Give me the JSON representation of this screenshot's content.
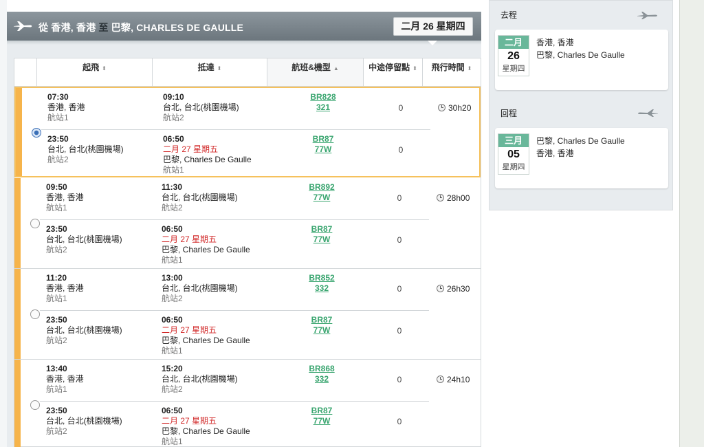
{
  "header": {
    "route_prefix": "從",
    "origin": "香港, 香港",
    "to_word": "至",
    "destination": "巴黎, CHARLES DE GAULLE",
    "selected_date": "二月 26 星期四"
  },
  "columns": [
    {
      "label": "起飛",
      "sort": "⬍"
    },
    {
      "label": "抵達",
      "sort": "⬍"
    },
    {
      "label": "航班&機型",
      "sort": "▲"
    },
    {
      "label": "中途停留點",
      "sort": "⬍"
    },
    {
      "label": "飛行時間",
      "sort": "⬍"
    }
  ],
  "itineraries": [
    {
      "selected": true,
      "duration": "30h20",
      "segments": [
        {
          "dep_time": "07:30",
          "dep_city": "香港, 香港",
          "dep_terminal": "航站1",
          "arr_time": "09:10",
          "arr_date": "",
          "arr_city": "台北, 台北(桃園機場)",
          "arr_terminal": "航站2",
          "flight": "BR828",
          "aircraft": "321",
          "stops": "0"
        },
        {
          "dep_time": "23:50",
          "dep_city": "台北, 台北(桃園機場)",
          "dep_terminal": "航站2",
          "arr_time": "06:50",
          "arr_date": "二月 27 星期五",
          "arr_city": "巴黎, Charles De Gaulle",
          "arr_terminal": "航站1",
          "flight": "BR87",
          "aircraft": "77W",
          "stops": "0"
        }
      ]
    },
    {
      "selected": false,
      "duration": "28h00",
      "segments": [
        {
          "dep_time": "09:50",
          "dep_city": "香港, 香港",
          "dep_terminal": "航站1",
          "arr_time": "11:30",
          "arr_date": "",
          "arr_city": "台北, 台北(桃園機場)",
          "arr_terminal": "航站2",
          "flight": "BR892",
          "aircraft": "77W",
          "stops": "0"
        },
        {
          "dep_time": "23:50",
          "dep_city": "台北, 台北(桃園機場)",
          "dep_terminal": "航站2",
          "arr_time": "06:50",
          "arr_date": "二月 27 星期五",
          "arr_city": "巴黎, Charles De Gaulle",
          "arr_terminal": "航站1",
          "flight": "BR87",
          "aircraft": "77W",
          "stops": "0"
        }
      ]
    },
    {
      "selected": false,
      "duration": "26h30",
      "segments": [
        {
          "dep_time": "11:20",
          "dep_city": "香港, 香港",
          "dep_terminal": "航站1",
          "arr_time": "13:00",
          "arr_date": "",
          "arr_city": "台北, 台北(桃園機場)",
          "arr_terminal": "航站2",
          "flight": "BR852",
          "aircraft": "332",
          "stops": "0"
        },
        {
          "dep_time": "23:50",
          "dep_city": "台北, 台北(桃園機場)",
          "dep_terminal": "航站2",
          "arr_time": "06:50",
          "arr_date": "二月 27 星期五",
          "arr_city": "巴黎, Charles De Gaulle",
          "arr_terminal": "航站1",
          "flight": "BR87",
          "aircraft": "77W",
          "stops": "0"
        }
      ]
    },
    {
      "selected": false,
      "duration": "24h10",
      "segments": [
        {
          "dep_time": "13:40",
          "dep_city": "香港, 香港",
          "dep_terminal": "航站1",
          "arr_time": "15:20",
          "arr_date": "",
          "arr_city": "台北, 台北(桃園機場)",
          "arr_terminal": "航站2",
          "flight": "BR868",
          "aircraft": "332",
          "stops": "0"
        },
        {
          "dep_time": "23:50",
          "dep_city": "台北, 台北(桃園機場)",
          "dep_terminal": "航站2",
          "arr_time": "06:50",
          "arr_date": "二月 27 星期五",
          "arr_city": "巴黎, Charles De Gaulle",
          "arr_terminal": "航站1",
          "flight": "BR87",
          "aircraft": "77W",
          "stops": "0"
        }
      ]
    }
  ],
  "sidebar": {
    "outbound": {
      "title": "去程",
      "month": "二月",
      "day": "26",
      "weekday": "星期四",
      "from": "香港, 香港",
      "to": "巴黎, Charles De Gaulle"
    },
    "return": {
      "title": "回程",
      "month": "三月",
      "day": "05",
      "weekday": "星期四",
      "from": "巴黎, Charles De Gaulle",
      "to": "香港, 香港"
    }
  },
  "colors": {
    "accent_green": "#39a56f",
    "selected_border": "#f6c15c",
    "date_red": "#d22b2b",
    "header_gray": "#7a848b"
  }
}
